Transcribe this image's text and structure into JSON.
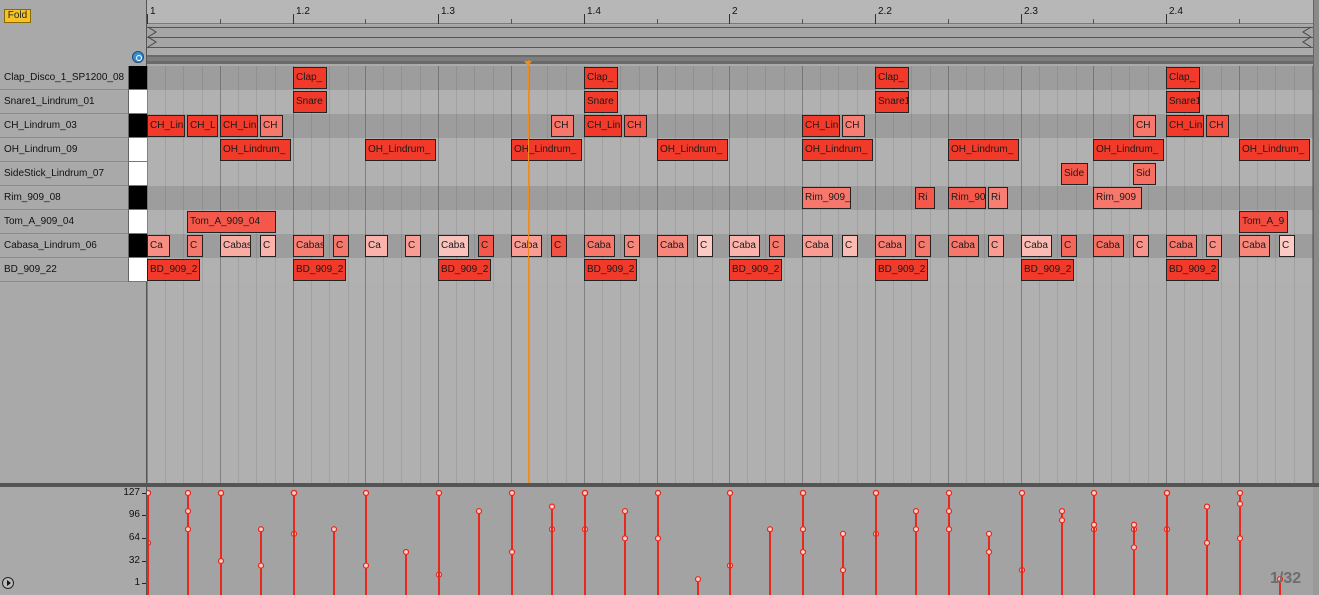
{
  "header": {
    "fold_label": "Fold"
  },
  "ruler": {
    "labels": [
      "1",
      "1.2",
      "1.3",
      "1.4",
      "2",
      "2.2",
      "2.3",
      "2.4"
    ]
  },
  "lanes": [
    {
      "name": "Clap_Disco_1_SP1200_08",
      "key": "black"
    },
    {
      "name": "Snare1_Lindrum_01",
      "key": "white"
    },
    {
      "name": "CH_Lindrum_03",
      "key": "black"
    },
    {
      "name": "OH_Lindrum_09",
      "key": "white"
    },
    {
      "name": "SideStick_Lindrum_07",
      "key": "white"
    },
    {
      "name": "Rim_909_08",
      "key": "black"
    },
    {
      "name": "Tom_A_909_04",
      "key": "white"
    },
    {
      "name": "Cabasa_Lindrum_06",
      "key": "black"
    },
    {
      "name": "BD_909_22",
      "key": "white"
    }
  ],
  "notes": [
    {
      "lane": 0,
      "start": 2,
      "len": 0.5,
      "label": "Clap_",
      "vel": 100
    },
    {
      "lane": 0,
      "start": 6,
      "len": 0.5,
      "label": "Clap_",
      "vel": 100
    },
    {
      "lane": 0,
      "start": 10,
      "len": 0.5,
      "label": "Clap_",
      "vel": 100
    },
    {
      "lane": 0,
      "start": 14,
      "len": 0.5,
      "label": "Clap_",
      "vel": 100
    },
    {
      "lane": 1,
      "start": 2,
      "len": 0.5,
      "label": "Snare",
      "vel": 100
    },
    {
      "lane": 1,
      "start": 6,
      "len": 0.5,
      "label": "Snare",
      "vel": 100
    },
    {
      "lane": 1,
      "start": 10,
      "len": 0.5,
      "label": "Snare1",
      "vel": 100
    },
    {
      "lane": 1,
      "start": 14,
      "len": 0.5,
      "label": "Snare1",
      "vel": 100
    },
    {
      "lane": 2,
      "start": 0,
      "len": 0.55,
      "label": "CH_Lin",
      "vel": 100
    },
    {
      "lane": 2,
      "start": 0.55,
      "len": 0.45,
      "label": "CH_L",
      "vel": 100
    },
    {
      "lane": 2,
      "start": 1,
      "len": 0.55,
      "label": "CH_Lin",
      "vel": 100
    },
    {
      "lane": 2,
      "start": 1.55,
      "len": 0.35,
      "label": "CH",
      "vel": 60
    },
    {
      "lane": 2,
      "start": 5.55,
      "len": 0.35,
      "label": "CH",
      "vel": 60
    },
    {
      "lane": 2,
      "start": 6,
      "len": 0.55,
      "label": "CH_Lin",
      "vel": 100
    },
    {
      "lane": 2,
      "start": 6.55,
      "len": 0.35,
      "label": "CH",
      "vel": 80
    },
    {
      "lane": 2,
      "start": 9,
      "len": 0.55,
      "label": "CH_Lin",
      "vel": 100
    },
    {
      "lane": 2,
      "start": 9.55,
      "len": 0.35,
      "label": "CH",
      "vel": 55
    },
    {
      "lane": 2,
      "start": 13.55,
      "len": 0.35,
      "label": "CH",
      "vel": 60
    },
    {
      "lane": 2,
      "start": 14,
      "len": 0.55,
      "label": "CH_Lin",
      "vel": 100
    },
    {
      "lane": 2,
      "start": 14.55,
      "len": 0.35,
      "label": "CH",
      "vel": 85
    },
    {
      "lane": 3,
      "start": 1,
      "len": 1,
      "label": "OH_Lindrum_",
      "vel": 100
    },
    {
      "lane": 3,
      "start": 3,
      "len": 1,
      "label": "OH_Lindrum_",
      "vel": 100
    },
    {
      "lane": 3,
      "start": 5,
      "len": 1,
      "label": "OH_Lindrum_",
      "vel": 100
    },
    {
      "lane": 3,
      "start": 7,
      "len": 1,
      "label": "OH_Lindrum_",
      "vel": 100
    },
    {
      "lane": 3,
      "start": 9,
      "len": 1,
      "label": "OH_Lindrum_",
      "vel": 100
    },
    {
      "lane": 3,
      "start": 11,
      "len": 1,
      "label": "OH_Lindrum_",
      "vel": 100
    },
    {
      "lane": 3,
      "start": 13,
      "len": 1,
      "label": "OH_Lindrum_",
      "vel": 100
    },
    {
      "lane": 3,
      "start": 15,
      "len": 1,
      "label": "OH_Lindrum_",
      "vel": 100
    },
    {
      "lane": 4,
      "start": 12.55,
      "len": 0.4,
      "label": "Side",
      "vel": 80
    },
    {
      "lane": 4,
      "start": 13.55,
      "len": 0.35,
      "label": "Sid",
      "vel": 65
    },
    {
      "lane": 5,
      "start": 9,
      "len": 0.7,
      "label": "Rim_909_",
      "vel": 60
    },
    {
      "lane": 5,
      "start": 10.55,
      "len": 0.3,
      "label": "Ri",
      "vel": 80
    },
    {
      "lane": 5,
      "start": 11,
      "len": 0.55,
      "label": "Rim_90",
      "vel": 80
    },
    {
      "lane": 5,
      "start": 11.55,
      "len": 0.3,
      "label": "Ri",
      "vel": 55
    },
    {
      "lane": 5,
      "start": 13,
      "len": 0.7,
      "label": "Rim_909",
      "vel": 60
    },
    {
      "lane": 6,
      "start": 0.55,
      "len": 1.25,
      "label": "Tom_A_909_04",
      "vel": 80
    },
    {
      "lane": 6,
      "start": 15,
      "len": 0.7,
      "label": "Tom_A_9",
      "vel": 88
    },
    {
      "lane": 7,
      "start": 0,
      "len": 0.35,
      "label": "Ca",
      "vel": 45
    },
    {
      "lane": 7,
      "start": 0.55,
      "len": 0.25,
      "label": "C",
      "vel": 60
    },
    {
      "lane": 7,
      "start": 1,
      "len": 0.45,
      "label": "Cabas",
      "vel": 25
    },
    {
      "lane": 7,
      "start": 1.55,
      "len": 0.25,
      "label": "C",
      "vel": 20
    },
    {
      "lane": 7,
      "start": 2,
      "len": 0.45,
      "label": "Cabas",
      "vel": 55
    },
    {
      "lane": 7,
      "start": 2.55,
      "len": 0.25,
      "label": "C",
      "vel": 60
    },
    {
      "lane": 7,
      "start": 3,
      "len": 0.35,
      "label": "Ca",
      "vel": 20
    },
    {
      "lane": 7,
      "start": 3.55,
      "len": 0.25,
      "label": "C",
      "vel": 35
    },
    {
      "lane": 7,
      "start": 4,
      "len": 0.45,
      "label": "Caba",
      "vel": 10
    },
    {
      "lane": 7,
      "start": 4.55,
      "len": 0.25,
      "label": "C",
      "vel": 80
    },
    {
      "lane": 7,
      "start": 5,
      "len": 0.45,
      "label": "Caba",
      "vel": 35
    },
    {
      "lane": 7,
      "start": 5.55,
      "len": 0.25,
      "label": "C",
      "vel": 85
    },
    {
      "lane": 7,
      "start": 6,
      "len": 0.45,
      "label": "Caba",
      "vel": 60
    },
    {
      "lane": 7,
      "start": 6.55,
      "len": 0.25,
      "label": "C",
      "vel": 50
    },
    {
      "lane": 7,
      "start": 7,
      "len": 0.45,
      "label": "Caba",
      "vel": 50
    },
    {
      "lane": 7,
      "start": 7.55,
      "len": 0.25,
      "label": "C",
      "vel": 5
    },
    {
      "lane": 7,
      "start": 8,
      "len": 0.45,
      "label": "Caba",
      "vel": 20
    },
    {
      "lane": 7,
      "start": 8.55,
      "len": 0.25,
      "label": "C",
      "vel": 60
    },
    {
      "lane": 7,
      "start": 9,
      "len": 0.45,
      "label": "Caba",
      "vel": 35
    },
    {
      "lane": 7,
      "start": 9.55,
      "len": 0.25,
      "label": "C",
      "vel": 15
    },
    {
      "lane": 7,
      "start": 10,
      "len": 0.45,
      "label": "Caba",
      "vel": 55
    },
    {
      "lane": 7,
      "start": 10.55,
      "len": 0.25,
      "label": "C",
      "vel": 60
    },
    {
      "lane": 7,
      "start": 11,
      "len": 0.45,
      "label": "Caba",
      "vel": 60
    },
    {
      "lane": 7,
      "start": 11.55,
      "len": 0.25,
      "label": "C",
      "vel": 35
    },
    {
      "lane": 7,
      "start": 12,
      "len": 0.45,
      "label": "Caba",
      "vel": 15
    },
    {
      "lane": 7,
      "start": 12.55,
      "len": 0.25,
      "label": "C",
      "vel": 70
    },
    {
      "lane": 7,
      "start": 13,
      "len": 0.45,
      "label": "Caba",
      "vel": 65
    },
    {
      "lane": 7,
      "start": 13.55,
      "len": 0.25,
      "label": "C",
      "vel": 40
    },
    {
      "lane": 7,
      "start": 14,
      "len": 0.45,
      "label": "Caba",
      "vel": 60
    },
    {
      "lane": 7,
      "start": 14.55,
      "len": 0.25,
      "label": "C",
      "vel": 45
    },
    {
      "lane": 7,
      "start": 15,
      "len": 0.45,
      "label": "Caba",
      "vel": 50
    },
    {
      "lane": 7,
      "start": 15.55,
      "len": 0.25,
      "label": "C",
      "vel": 5
    },
    {
      "lane": 8,
      "start": 0,
      "len": 0.75,
      "label": "BD_909_2",
      "vel": 100
    },
    {
      "lane": 8,
      "start": 2,
      "len": 0.75,
      "label": "BD_909_2",
      "vel": 100
    },
    {
      "lane": 8,
      "start": 4,
      "len": 0.75,
      "label": "BD_909_2",
      "vel": 100
    },
    {
      "lane": 8,
      "start": 6,
      "len": 0.75,
      "label": "BD_909_2",
      "vel": 100
    },
    {
      "lane": 8,
      "start": 8,
      "len": 0.75,
      "label": "BD_909_2",
      "vel": 100
    },
    {
      "lane": 8,
      "start": 10,
      "len": 0.75,
      "label": "BD_909_2",
      "vel": 100
    },
    {
      "lane": 8,
      "start": 12,
      "len": 0.75,
      "label": "BD_909_2",
      "vel": 100
    },
    {
      "lane": 8,
      "start": 14,
      "len": 0.75,
      "label": "BD_909_2",
      "vel": 100
    }
  ],
  "velocity": {
    "scale_labels": [
      "127",
      "96",
      "64",
      "32",
      "1"
    ],
    "scale_values": [
      127,
      96,
      64,
      32,
      1
    ],
    "color": "#e8281c"
  },
  "playhead": {
    "color": "#f08a1c"
  },
  "footer": {
    "grid_label": "1/32"
  },
  "colors": {
    "note_loud": "#f23a2a",
    "note_soft": "#fbd0cb",
    "fold": "#f6c325"
  }
}
